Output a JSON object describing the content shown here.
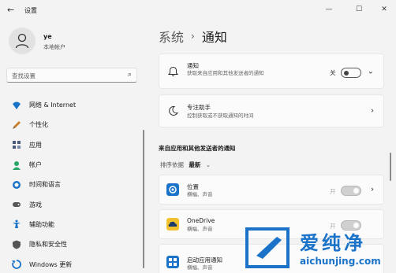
{
  "titlebar": {
    "title": "设置",
    "back_glyph": "←",
    "minimize_glyph": "—",
    "maximize_glyph": "☐",
    "close_glyph": "✕"
  },
  "profile": {
    "name": "ye",
    "subtitle": "本地帐户"
  },
  "search": {
    "placeholder": "查找设置",
    "icon": "search-icon"
  },
  "sidebar": {
    "items": [
      {
        "label": "网络 & Internet",
        "icon": "network-icon",
        "color": "#1a73c9"
      },
      {
        "label": "个性化",
        "icon": "brush-icon",
        "color": "#c97a2a"
      },
      {
        "label": "应用",
        "icon": "apps-icon",
        "color": "#4a5a7a"
      },
      {
        "label": "帐户",
        "icon": "person-icon",
        "color": "#2aa66a"
      },
      {
        "label": "时间和语言",
        "icon": "globe-clock-icon",
        "color": "#1a73c9"
      },
      {
        "label": "游戏",
        "icon": "gamepad-icon",
        "color": "#555555"
      },
      {
        "label": "辅助功能",
        "icon": "accessibility-icon",
        "color": "#1a73c9"
      },
      {
        "label": "隐私和安全性",
        "icon": "shield-icon",
        "color": "#555555"
      },
      {
        "label": "Windows 更新",
        "icon": "update-icon",
        "color": "#1a73c9"
      }
    ]
  },
  "breadcrumb": {
    "parent": "系统",
    "separator": "›",
    "current": "通知"
  },
  "notifications_card": {
    "title": "通知",
    "subtitle": "获取来自应用和其他发送者的通知",
    "toggle_state": "关",
    "toggle_on": false,
    "icon": "bell-icon"
  },
  "focus_card": {
    "title": "专注助手",
    "subtitle": "控制获取或不获取通知的时间",
    "icon": "moon-icon"
  },
  "apps_section": {
    "title": "来自应用和其他发送者的通知",
    "sort_label": "排序依据",
    "sort_value": "最新",
    "apps": [
      {
        "name": "位置",
        "detail": "横幅、声音",
        "toggle_state": "开",
        "icon": "location-app-icon",
        "color": "#1a73c9"
      },
      {
        "name": "OneDrive",
        "detail": "横幅、声音",
        "toggle_state": "开",
        "icon": "onedrive-app-icon",
        "color": "#f2c12e"
      },
      {
        "name": "启动应用通知",
        "detail": "横幅、声音",
        "icon": "startup-app-icon",
        "color": "#1a73c9"
      }
    ]
  },
  "watermark": {
    "text": "爱纯净",
    "url": "aichunjing.com",
    "color": "#1a73c9"
  }
}
